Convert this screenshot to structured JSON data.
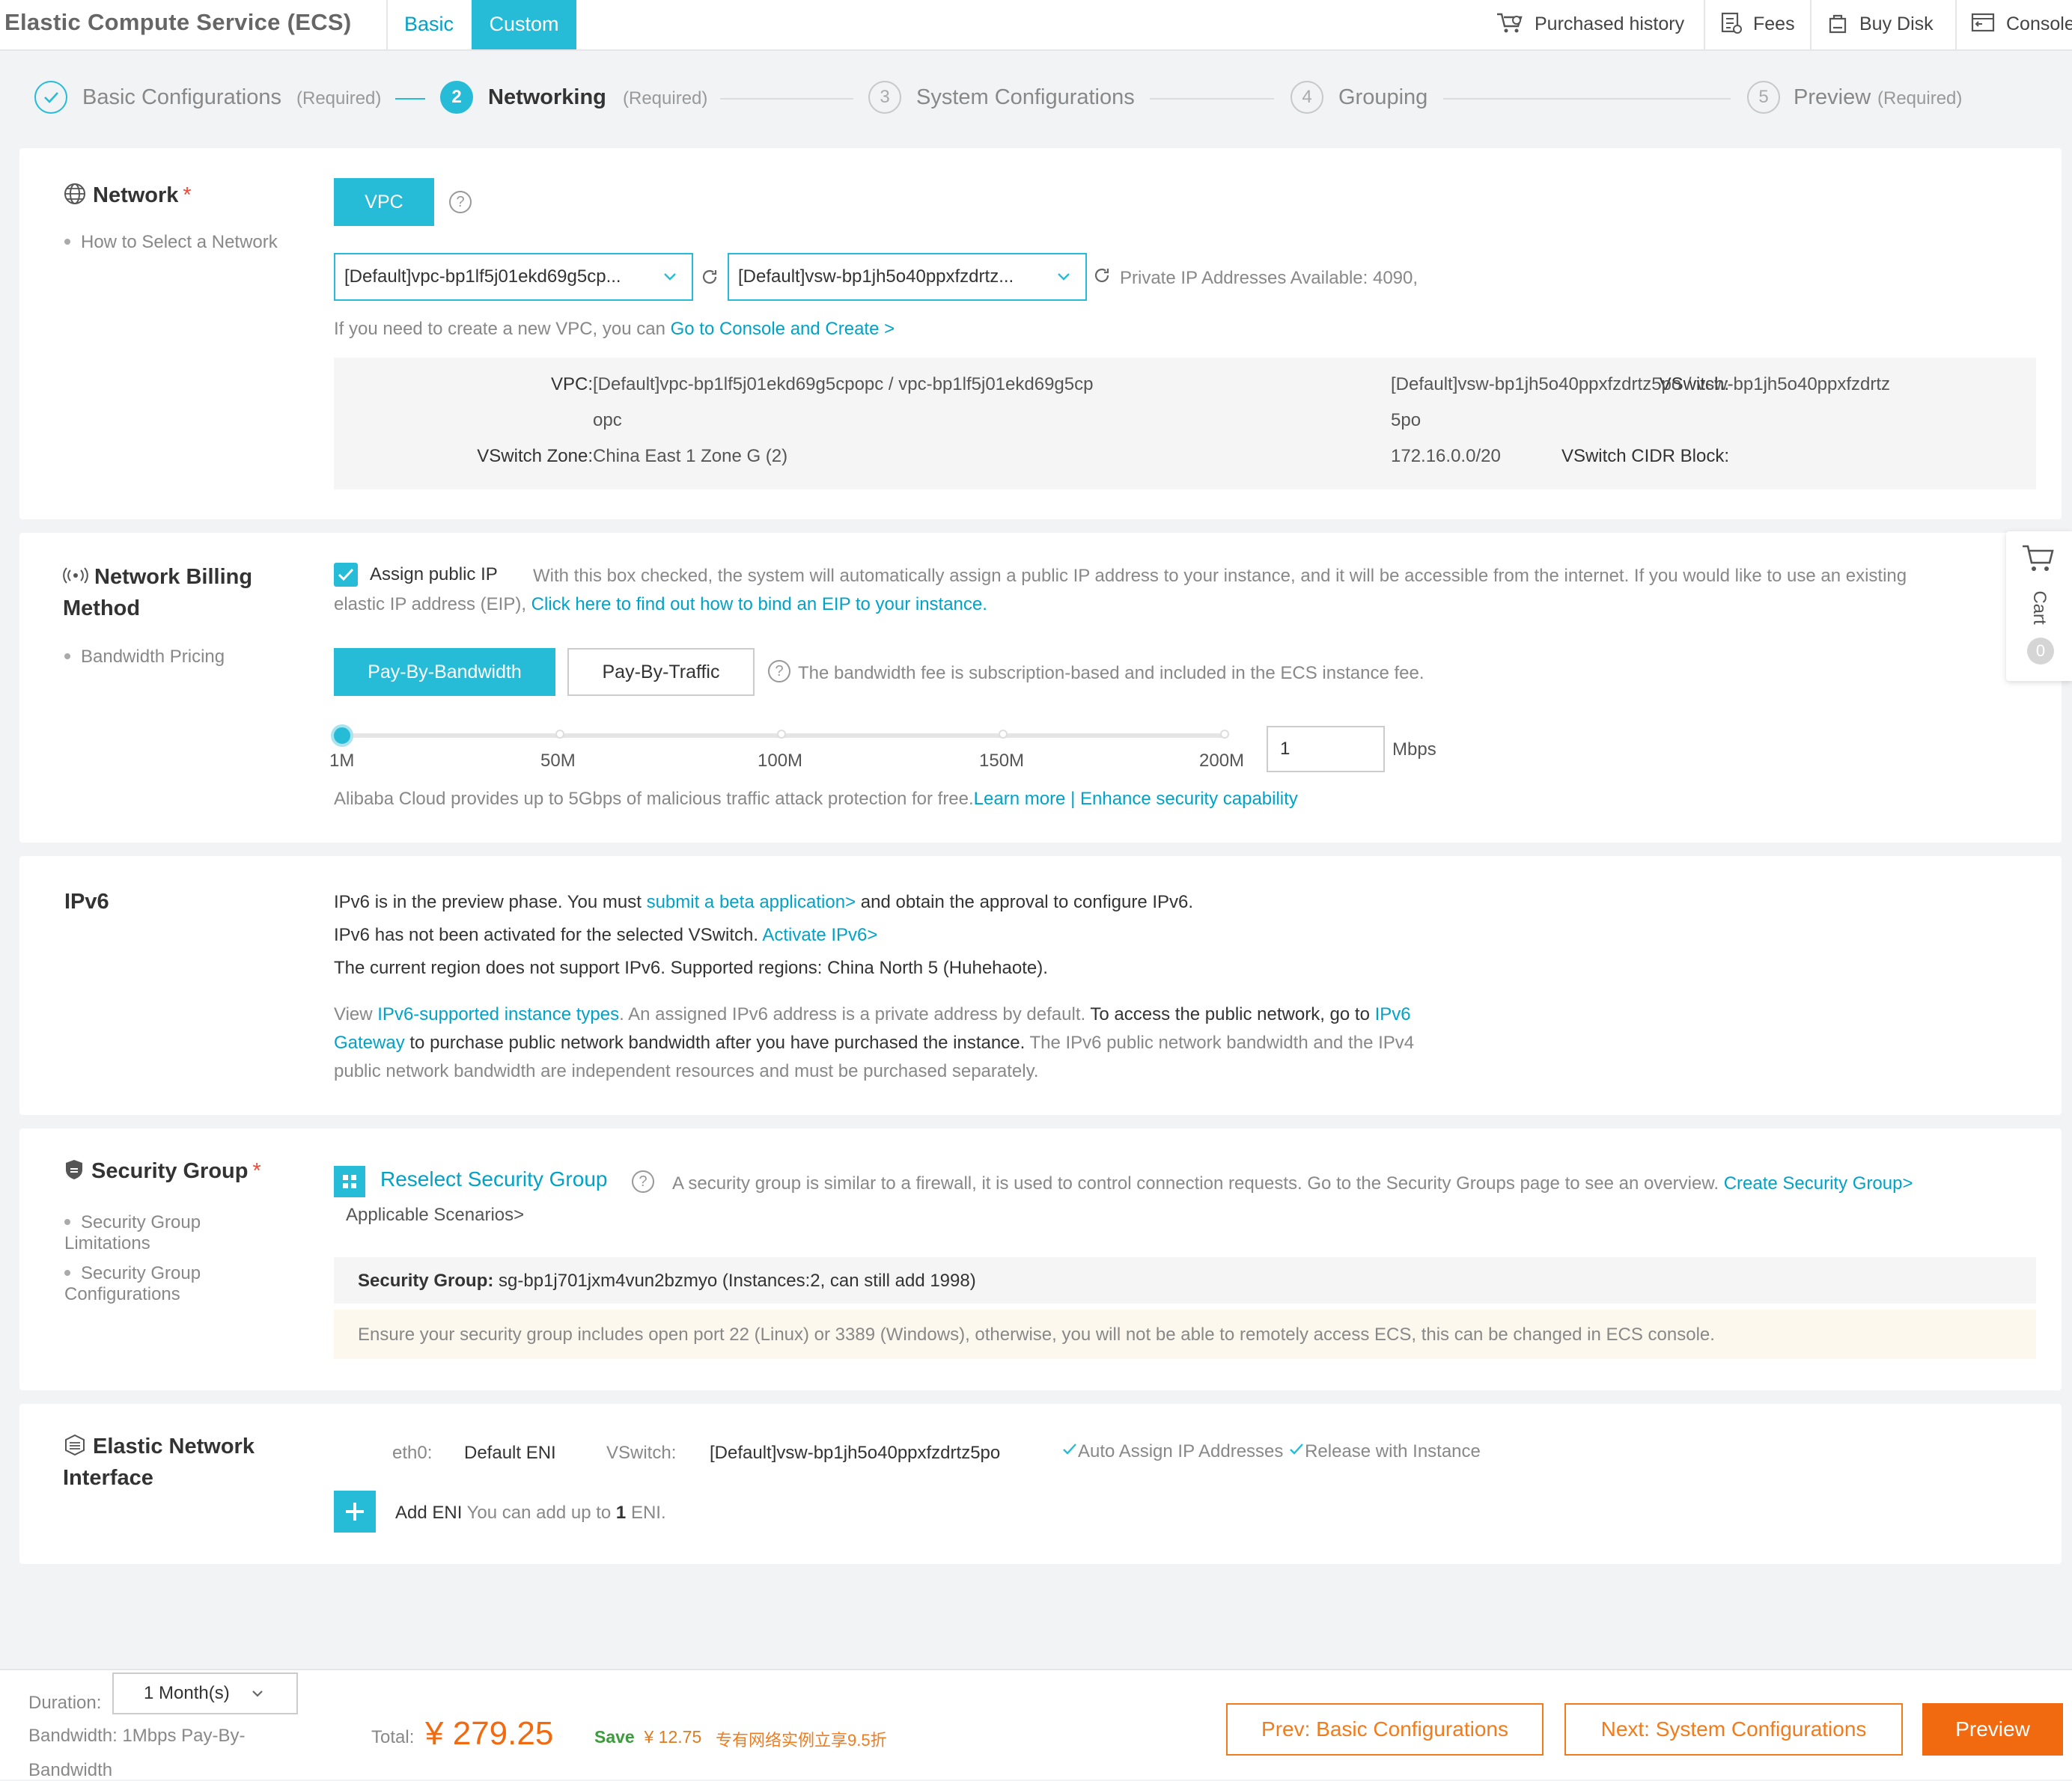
{
  "app_title": "Elastic Compute Service (ECS)",
  "mode_tabs": {
    "basic": "Basic",
    "custom": "Custom"
  },
  "top_links": {
    "purchased_history": "Purchased history",
    "fees": "Fees",
    "buy_disk": "Buy Disk",
    "console": "Console"
  },
  "steps": [
    {
      "label": "Basic Configurations",
      "required": "(Required)",
      "state": "done"
    },
    {
      "number": "2",
      "label": "Networking",
      "required": "(Required)",
      "state": "active"
    },
    {
      "number": "3",
      "label": "System Configurations",
      "state": "idle"
    },
    {
      "number": "4",
      "label": "Grouping",
      "state": "idle"
    },
    {
      "number": "5",
      "label": "Preview",
      "required": "(Required)",
      "state": "idle"
    }
  ],
  "network": {
    "title": "Network",
    "required_mark": "*",
    "help_link": "How to Select a Network",
    "vpc_button": "VPC",
    "vpc_select": "[Default]vpc-bp1lf5j01ekd69g5cp...",
    "vswitch_select": "[Default]vsw-bp1jh5o40ppxfzdrtz...",
    "private_ip_text": "Private IP Addresses Available: 4090,",
    "create_hint": "If you need to create a new VPC, you can ",
    "create_link": "Go to Console and Create >",
    "details": {
      "vpc_key": "VPC:",
      "vpc_value_line1": "[Default]vpc-bp1lf5j01ekd69g5cpopc / vpc-bp1lf5j01ekd69g5cp",
      "vpc_value_line2": "opc",
      "vswitch_key": "VSwitch:",
      "vswitch_value_line1": "[Default]vsw-bp1jh5o40ppxfzdrtz5po / vsw-bp1jh5o40ppxfzdrtz",
      "vswitch_value_line2": "5po",
      "zone_key": "VSwitch Zone:",
      "zone_value": "China East 1 Zone G (2)",
      "cidr_key": "VSwitch CIDR Block:",
      "cidr_value": "172.16.0.0/20"
    }
  },
  "billing": {
    "title_line1": "Network Billing",
    "title_line2": "Method",
    "help_link": "Bandwidth Pricing",
    "assign_public_ip_checked": true,
    "assign_public_ip_label": "Assign public IP",
    "assign_desc_line1": "With this box checked, the system will automatically assign a public IP address to your instance, and it will be accessible from the internet. If you would like to use an existing",
    "assign_desc_line2": "elastic IP address (EIP), ",
    "assign_desc_link": "Click here to find out how to bind an EIP to your instance.",
    "pay_by_bandwidth": "Pay-By-Bandwidth",
    "pay_by_traffic": "Pay-By-Traffic",
    "fee_note": "The bandwidth fee is subscription-based and included in the ECS instance fee.",
    "slider_labels": [
      "1M",
      "50M",
      "100M",
      "150M",
      "200M"
    ],
    "bandwidth_value": "1",
    "bandwidth_unit": "Mbps",
    "protection_text": "Alibaba Cloud provides up to 5Gbps of malicious traffic attack protection for free.",
    "learn_more": "Learn more",
    "separator": "|",
    "enhance_link": "Enhance security capability"
  },
  "ipv6": {
    "title": "IPv6",
    "line1_a": "IPv6 is in the preview phase. You must ",
    "line1_link": "submit a beta application>",
    "line1_b": " and obtain the approval to configure IPv6.",
    "line2_a": "IPv6 has not been activated for the selected VSwitch. ",
    "line2_link": "Activate IPv6>",
    "line3": "The current region does not support IPv6. Supported regions: China North 5 (Huhehaote).",
    "note_view": "View ",
    "note_link1": "IPv6-supported instance types",
    "note_a": ". An assigned IPv6 address is a private address by default. ",
    "note_b": "To access the public network, go to ",
    "note_link2a": "IPv6",
    "note_link2b": "Gateway",
    "note_c": " to purchase public network bandwidth after you have purchased the instance.",
    "note_d": " The IPv6 public network bandwidth and the IPv4",
    "note_e": "public network bandwidth are independent resources and must be purchased separately."
  },
  "security": {
    "title": "Security Group",
    "required_mark": "*",
    "link1_line1": "Security Group",
    "link1_line2": "Limitations",
    "link2_line1": "Security Group",
    "link2_line2": "Configurations",
    "reselect": "Reselect Security Group",
    "desc": "A security group is similar to a firewall, it is used to control connection requests. Go to the Security Groups page to see an overview. ",
    "create_link": "Create Security Group>",
    "scenarios_link": "Applicable Scenarios>",
    "group_key": "Security Group:",
    "group_value": " sg-bp1j701jxm4vun2bzmyo (Instances:2, can still add 1998)",
    "warning": "Ensure your security group includes open port 22 (Linux) or 3389 (Windows), otherwise, you will not be able to remotely access ECS, this can be changed in ECS console."
  },
  "eni": {
    "title_line1": "Elastic Network",
    "title_line2": "Interface",
    "eth_key": "eth0:",
    "eth_value": "Default ENI",
    "vswitch_key": "VSwitch:",
    "vswitch_value": "[Default]vsw-bp1jh5o40ppxfzdrtz5po",
    "auto_assign": "Auto Assign IP Addresses",
    "release": "Release with Instance",
    "add_label": "Add ENI",
    "add_note_a": " You can add up to ",
    "add_note_num": "1",
    "add_note_b": " ENI."
  },
  "cart": {
    "label": "Cart",
    "count": "0"
  },
  "footer": {
    "duration_label": "Duration:",
    "duration_value": "1 Month(s)",
    "bandwidth_line1": "Bandwidth: 1Mbps Pay-By-",
    "bandwidth_line2": "Bandwidth",
    "total_label": "Total:",
    "currency": "¥",
    "total_value": "279.25",
    "save_label": "Save",
    "save_value": "¥ 12.75",
    "promo": "专有网络实例立享9.5折",
    "prev_button": "Prev: Basic Configurations",
    "next_button": "Next: System Configurations",
    "preview_button": "Preview"
  },
  "colors": {
    "accent": "#26bcd7",
    "link": "#00a3c8",
    "orange": "#f26a10",
    "required": "#e74c3c"
  }
}
